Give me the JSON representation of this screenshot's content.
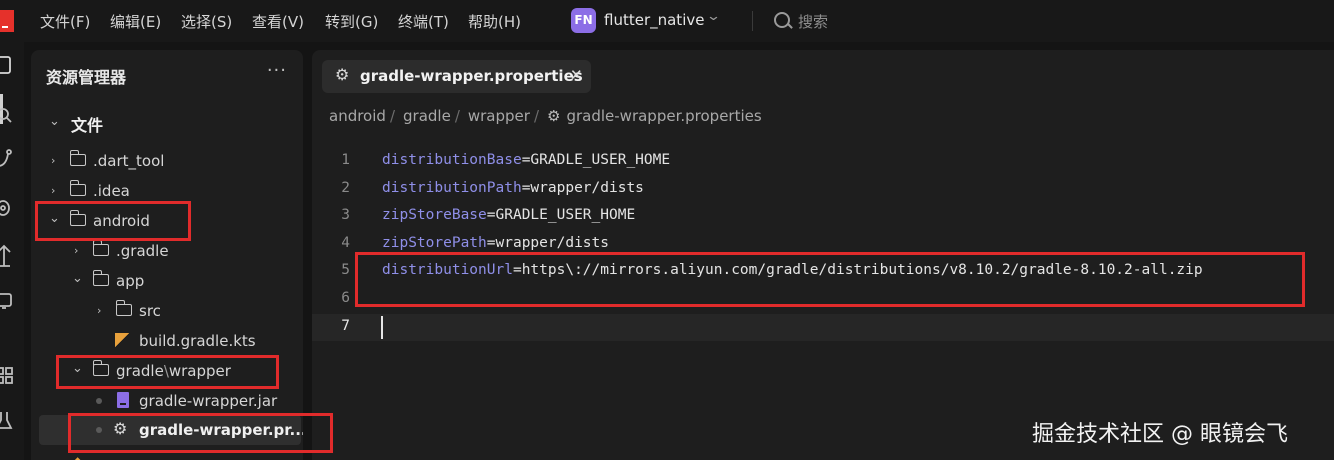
{
  "menubar": {
    "items": [
      "文件(F)",
      "编辑(E)",
      "选择(S)",
      "查看(V)",
      "转到(G)",
      "终端(T)",
      "帮助(H)"
    ],
    "project_badge": "FN",
    "project_name": "flutter_native",
    "search_label": "搜索"
  },
  "explorer": {
    "title": "资源管理器",
    "more": "···",
    "section_label": "文件",
    "items": {
      "dart_tool": ".dart_tool",
      "idea": ".idea",
      "android": "android",
      "gradle_dir": ".gradle",
      "app": "app",
      "src": "src",
      "build_gradle": "build.gradle.kts",
      "gradle": "gradle",
      "path_sep": "\\",
      "wrapper": "wrapper",
      "wrapper_jar": "gradle-wrapper.jar",
      "wrapper_props": "gradle-wrapper.pr..."
    }
  },
  "editor": {
    "tab_label": "gradle-wrapper.properties",
    "tab_close": "✕",
    "breadcrumbs": [
      "android",
      "gradle",
      "wrapper",
      "gradle-wrapper.properties"
    ],
    "breadcrumb_sep": "/",
    "lines": [
      {
        "num": "1",
        "key": "distributionBase",
        "eq": "=",
        "value": "GRADLE_USER_HOME"
      },
      {
        "num": "2",
        "key": "distributionPath",
        "eq": "=",
        "value": "wrapper/dists"
      },
      {
        "num": "3",
        "key": "zipStoreBase",
        "eq": "=",
        "value": "GRADLE_USER_HOME"
      },
      {
        "num": "4",
        "key": "zipStorePath",
        "eq": "=",
        "value": "wrapper/dists"
      },
      {
        "num": "5",
        "key": "distributionUrl",
        "eq": "=",
        "value": "https\\://mirrors.aliyun.com/gradle/distributions/v8.10.2/gradle-8.10.2-all.zip"
      },
      {
        "num": "6",
        "key": "",
        "eq": "",
        "value": ""
      },
      {
        "num": "7",
        "key": "",
        "eq": "",
        "value": ""
      }
    ],
    "active_line": "7"
  },
  "watermark": "掘金技术社区 @ 眼镜会飞",
  "colors": {
    "annotation_red": "#e12b2b",
    "property_key": "#8f8fe8",
    "project_badge": "#8c6ee6",
    "logo_red": "#e5312b"
  }
}
